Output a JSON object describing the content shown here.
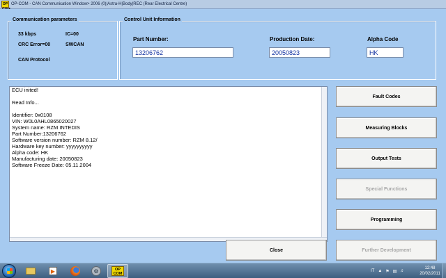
{
  "window": {
    "icon_text": "OP COM",
    "title": "OP-COM - CAN Communication Window> 2006 (0)|Astra-H|Body|REC (Rear Electrical Centre)"
  },
  "comm": {
    "title": "Communication parameters",
    "speed": "33 kbps",
    "ic": "IC=00",
    "crc": "CRC Error=00",
    "bus": "SWCAN",
    "protocol": "CAN Protocol"
  },
  "ecu_info": {
    "title": "Control Unit Information",
    "part_number_label": "Part Number:",
    "part_number": "13206762",
    "production_date_label": "Production Date:",
    "production_date": "20050823",
    "alpha_code_label": "Alpha Code",
    "alpha_code": "HK"
  },
  "log": [
    "ECU inited!",
    "",
    "Read Info...",
    "",
    "Identifier: 0x0108",
    "VIN: W0L0AHL0865020027",
    "System name: RZM INTEDIS",
    "Part Number:13206762",
    "Software version number: RZM 8.12/",
    "Hardware key number: yyyyyyyyyy",
    "Alpha code:  HK",
    "Manufacturing date: 20050823",
    "Software Freeze Date: 05.11.2004"
  ],
  "buttons": {
    "fault_codes": "Fault Codes",
    "measuring_blocks": "Measuring Blocks",
    "output_tests": "Output Tests",
    "special_functions": "Special Functions",
    "programming": "Programming",
    "further_development": "Further Development",
    "close": "Close"
  },
  "taskbar": {
    "opcom_label": "OP COM",
    "language": "IT",
    "time": "12:48",
    "date": "20/02/2011"
  }
}
